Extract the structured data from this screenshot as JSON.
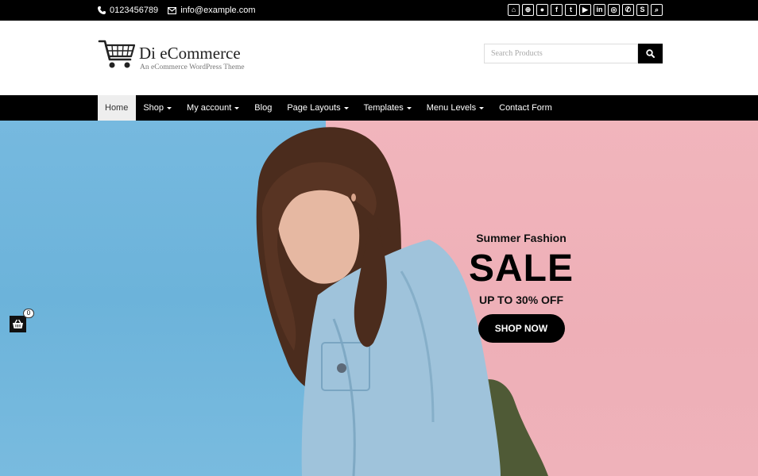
{
  "topbar": {
    "phone": "0123456789",
    "email": "info@example.com",
    "icons": [
      {
        "name": "shopping-bag-icon",
        "glyph": "⌂"
      },
      {
        "name": "cart-icon",
        "glyph": "⊕"
      },
      {
        "name": "user-icon",
        "glyph": "●"
      },
      {
        "name": "facebook-icon",
        "glyph": "f"
      },
      {
        "name": "twitter-icon",
        "glyph": "t"
      },
      {
        "name": "youtube-icon",
        "glyph": "▶"
      },
      {
        "name": "linkedin-icon",
        "glyph": "in"
      },
      {
        "name": "instagram-icon",
        "glyph": "◎"
      },
      {
        "name": "whatsapp-icon",
        "glyph": "✆"
      },
      {
        "name": "skype-icon",
        "glyph": "S"
      },
      {
        "name": "search-icon",
        "glyph": "⌕"
      }
    ]
  },
  "header": {
    "title": "Di eCommerce",
    "tagline": "An eCommerce WordPress Theme",
    "search_placeholder": "Search Products"
  },
  "nav": {
    "items": [
      {
        "label": "Home",
        "active": true,
        "dropdown": false
      },
      {
        "label": "Shop",
        "active": false,
        "dropdown": true
      },
      {
        "label": "My account",
        "active": false,
        "dropdown": true
      },
      {
        "label": "Blog",
        "active": false,
        "dropdown": false
      },
      {
        "label": "Page Layouts",
        "active": false,
        "dropdown": true
      },
      {
        "label": "Templates",
        "active": false,
        "dropdown": true
      },
      {
        "label": "Menu Levels",
        "active": false,
        "dropdown": true
      },
      {
        "label": "Contact Form",
        "active": false,
        "dropdown": false
      }
    ]
  },
  "hero": {
    "subtitle": "Summer Fashion",
    "headline": "SALE",
    "offer": "UP TO 30% OFF",
    "cta": "SHOP NOW"
  },
  "floating_cart": {
    "count": "0"
  },
  "colors": {
    "bar": "#000000",
    "accent_blue": "#6cb3da",
    "accent_pink": "#eeafb7"
  }
}
